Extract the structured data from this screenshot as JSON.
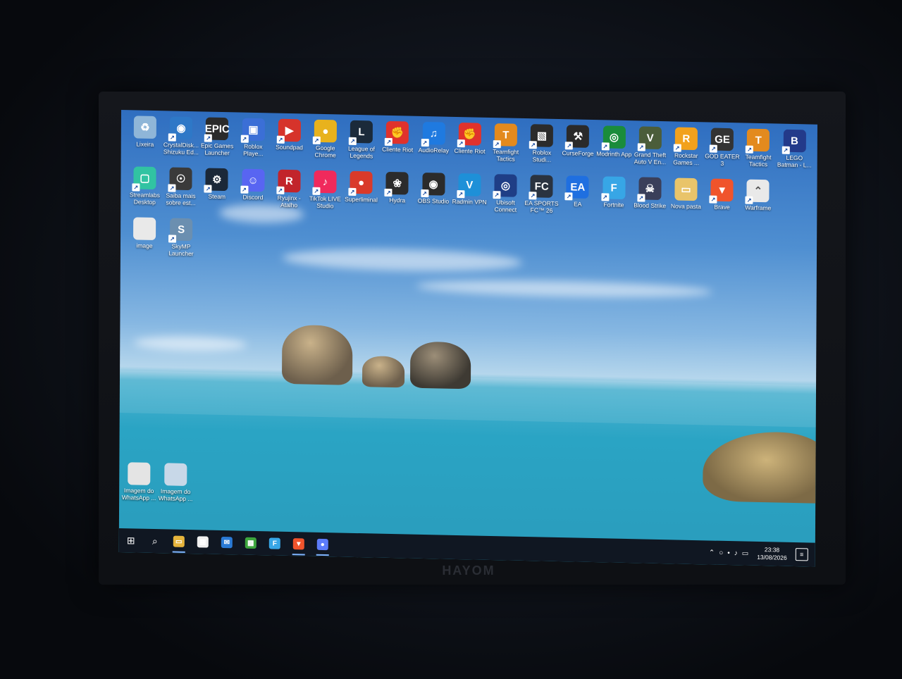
{
  "monitor": {
    "brand": "HAYOM"
  },
  "desktop_icons": [
    {
      "label": "Lixeira",
      "icon": "recycle-bin-icon",
      "color": "#8fb6d8",
      "glyph": "♻",
      "shortcut": false
    },
    {
      "label": "CrystalDisk... Shizuku Ed...",
      "icon": "crystaldisk-icon",
      "color": "#2e78c7",
      "glyph": "◉"
    },
    {
      "label": "Epic Games Launcher",
      "icon": "epic-games-icon",
      "color": "#2a2a2a",
      "glyph": "EPIC"
    },
    {
      "label": "Roblox Playe...",
      "icon": "roblox-player-icon",
      "color": "#3b6fd6",
      "glyph": "▣"
    },
    {
      "label": "Soundpad",
      "icon": "soundpad-icon",
      "color": "#d6332b",
      "glyph": "▶"
    },
    {
      "label": "Google Chrome",
      "icon": "chrome-icon",
      "color": "#e8b21d",
      "glyph": "●"
    },
    {
      "label": "League of Legends",
      "icon": "league-icon",
      "color": "#1b2a3a",
      "glyph": "L"
    },
    {
      "label": "Cliente Riot",
      "icon": "riot-client-icon",
      "color": "#e0322c",
      "glyph": "✊"
    },
    {
      "label": "AudioRelay",
      "icon": "audiorelay-icon",
      "color": "#1f7ae0",
      "glyph": "♫"
    },
    {
      "label": "Cliente Riot",
      "icon": "riot-client-icon",
      "color": "#e0322c",
      "glyph": "✊"
    },
    {
      "label": "Teamfight Tactics",
      "icon": "tft-icon",
      "color": "#e38a1e",
      "glyph": "T"
    },
    {
      "label": "Roblox Studi...",
      "icon": "roblox-studio-icon",
      "color": "#2b2b2b",
      "glyph": "▧"
    },
    {
      "label": "CurseForge",
      "icon": "curseforge-icon",
      "color": "#2a2a2a",
      "glyph": "⚒"
    },
    {
      "label": "Modrinth App",
      "icon": "modrinth-icon",
      "color": "#1a8c3b",
      "glyph": "◎"
    },
    {
      "label": "Grand Theft Auto V En...",
      "icon": "gta-icon",
      "color": "#4b5d3a",
      "glyph": "V"
    },
    {
      "label": "Rockstar Games ...",
      "icon": "rockstar-icon",
      "color": "#f2a11c",
      "glyph": "R"
    },
    {
      "label": "GOD EATER 3",
      "icon": "god-eater-icon",
      "color": "#333",
      "glyph": "GE"
    },
    {
      "label": "Teamfight Tactics",
      "icon": "tft-icon",
      "color": "#e38a1e",
      "glyph": "T"
    },
    {
      "label": "LEGO Batman - L...",
      "icon": "lego-batman-icon",
      "color": "#233a8a",
      "glyph": "B"
    },
    {
      "label": "Streamlabs Desktop",
      "icon": "streamlabs-icon",
      "color": "#31c3a2",
      "glyph": "▢"
    },
    {
      "label": "Saiba mais sobre est...",
      "icon": "learn-more-icon",
      "color": "#3a3a3a",
      "glyph": "☉"
    },
    {
      "label": "Steam",
      "icon": "steam-icon",
      "color": "#1b2838",
      "glyph": "⚙"
    },
    {
      "label": "Discord",
      "icon": "discord-icon",
      "color": "#5865f2",
      "glyph": "☺"
    },
    {
      "label": "Ryujinx - Atalho",
      "icon": "ryujinx-icon",
      "color": "#c2242b",
      "glyph": "R"
    },
    {
      "label": "TikTok LIVE Studio",
      "icon": "tiktok-live-icon",
      "color": "#f02a5c",
      "glyph": "♪"
    },
    {
      "label": "Superliminal",
      "icon": "superliminal-icon",
      "color": "#d93a2a",
      "glyph": "●"
    },
    {
      "label": "Hydra",
      "icon": "hydra-icon",
      "color": "#2b2b2b",
      "glyph": "❀"
    },
    {
      "label": "OBS Studio",
      "icon": "obs-icon",
      "color": "#2b2b2b",
      "glyph": "◉"
    },
    {
      "label": "Radmin VPN",
      "icon": "radmin-vpn-icon",
      "color": "#1e90d8",
      "glyph": "V"
    },
    {
      "label": "Ubisoft Connect",
      "icon": "ubisoft-icon",
      "color": "#1f3e86",
      "glyph": "◎"
    },
    {
      "label": "EA SPORTS FC™ 26",
      "icon": "ea-fc-icon",
      "color": "#2a3340",
      "glyph": "FC"
    },
    {
      "label": "EA",
      "icon": "ea-icon",
      "color": "#1f6fe0",
      "glyph": "EA"
    },
    {
      "label": "Fortnite",
      "icon": "fortnite-icon",
      "color": "#37a6e6",
      "glyph": "F"
    },
    {
      "label": "Blood Strike",
      "icon": "blood-strike-icon",
      "color": "#3a3f5a",
      "glyph": "☠"
    },
    {
      "label": "Nova pasta",
      "icon": "folder-icon",
      "color": "#e9c46a",
      "glyph": "▭",
      "shortcut": false
    },
    {
      "label": "Brave",
      "icon": "brave-icon",
      "color": "#f0542c",
      "glyph": "▼"
    },
    {
      "label": "Warframe",
      "icon": "warframe-icon",
      "color": "#e9e9e9",
      "glyph": "⌃"
    },
    {
      "label": "image",
      "icon": "image-file-icon",
      "color": "#e9e9e9",
      "glyph": "",
      "shortcut": false
    },
    {
      "label": "SkyMP Launcher",
      "icon": "skymp-icon",
      "color": "#6b8fb0",
      "glyph": "S"
    },
    {
      "label": "Imagem do WhatsApp ...",
      "icon": "image-file-icon",
      "color": "#e4e4e4",
      "glyph": "",
      "shortcut": false
    },
    {
      "label": "Imagem do WhatsApp ...",
      "icon": "image-file-icon",
      "color": "#c8d8e8",
      "glyph": "",
      "shortcut": false
    }
  ],
  "taskbar": {
    "start_icon": "windows-start-icon",
    "items": [
      {
        "name": "search-icon",
        "glyph": "⌕"
      },
      {
        "name": "file-explorer-icon",
        "glyph": "▭",
        "color": "#e6b43c",
        "active": true
      },
      {
        "name": "microsoft-store-icon",
        "glyph": "▦",
        "color": "#f0f0f0"
      },
      {
        "name": "mail-icon",
        "glyph": "✉",
        "color": "#2a7ad5"
      },
      {
        "name": "minecraft-icon",
        "glyph": "▩",
        "color": "#3da63d"
      },
      {
        "name": "fortnite-taskbar-icon",
        "glyph": "F",
        "color": "#37a6e6"
      },
      {
        "name": "brave-taskbar-icon",
        "glyph": "▼",
        "color": "#f0542c",
        "active": true
      },
      {
        "name": "app-taskbar-icon",
        "glyph": "●",
        "color": "#5c7cfa",
        "active": true
      }
    ],
    "clock": {
      "time": "23:38",
      "date": "13/08/2026"
    }
  }
}
